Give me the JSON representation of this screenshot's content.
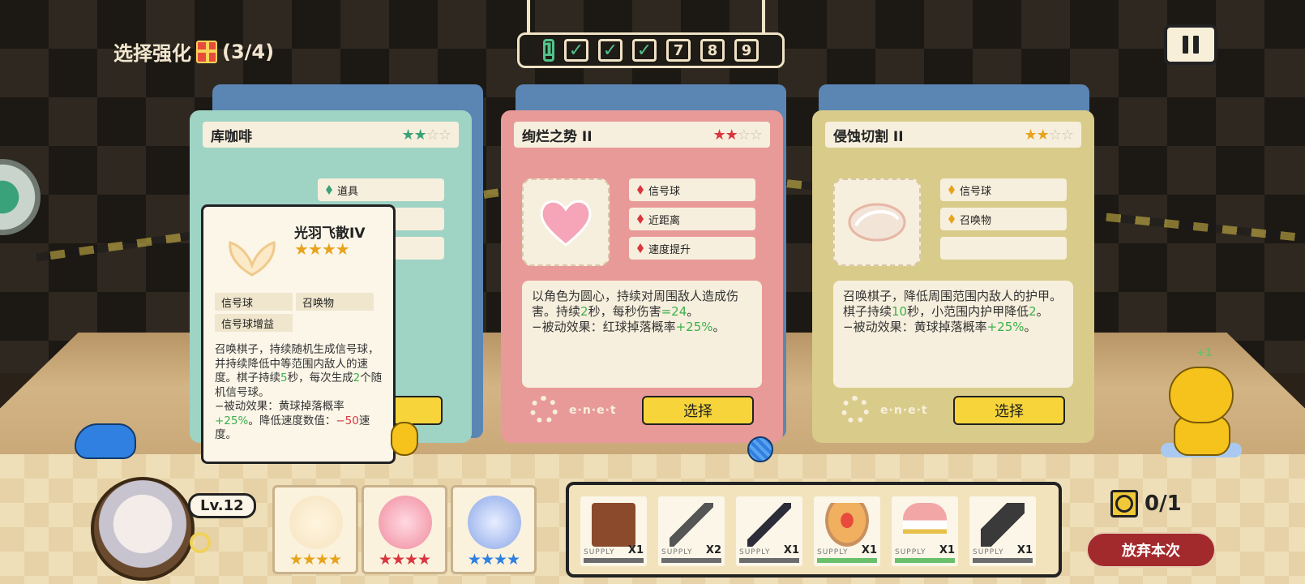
{
  "header": {
    "title": "选择强化",
    "progress": "(3/4)",
    "gift_icon": "gift-icon"
  },
  "stages": {
    "current_marker": "1",
    "done": [
      "✓",
      "✓",
      "✓"
    ],
    "upcoming": [
      "7",
      "8",
      "9"
    ]
  },
  "cards": [
    {
      "name": "库咖啡",
      "stars_filled": "★★",
      "stars_empty": "☆☆",
      "accent": "#3aa27a",
      "tags": [
        "道具"
      ],
      "select_label": "择"
    },
    {
      "name": "绚烂之势 II",
      "stars_filled": "★★",
      "stars_empty": "☆☆",
      "accent": "#d9363e",
      "tags": [
        "信号球",
        "近距离",
        "速度提升"
      ],
      "desc_a": "以角色为圆心，持续对周围敌人造成伤害。持续",
      "desc_b": "2",
      "desc_c": "秒，每秒伤害",
      "desc_d": "=24",
      "desc_e": "。",
      "passive_a": "−被动效果：红球掉落概率",
      "passive_b": "+25%",
      "passive_c": "。",
      "deco_text": "e·n·e·t",
      "select_label": "选择"
    },
    {
      "name": "侵蚀切割 II",
      "stars_filled": "★★",
      "stars_empty": "☆☆",
      "accent": "#e8a31c",
      "tags": [
        "信号球",
        "召唤物"
      ],
      "desc_a": "召唤棋子，降低周围范围内敌人的护甲。棋子持续",
      "desc_b": "10",
      "desc_c": "秒，小范围内护甲降低",
      "desc_d": "2",
      "desc_e": "。",
      "passive_a": "−被动效果：黄球掉落概率",
      "passive_b": "+25%",
      "passive_c": "。",
      "deco_text": "e·n·e·t",
      "select_label": "选择"
    }
  ],
  "tooltip": {
    "name": "光羽飞散IV",
    "stars": "★★★★",
    "tags": [
      "信号球",
      "召唤物",
      "信号球增益"
    ],
    "desc_1": "召唤棋子，持续随机生成信号球，并持续降低中等范围内敌人的速度。棋子持续",
    "desc_2": "5",
    "desc_3": "秒，每次生成",
    "desc_4": "2",
    "desc_5": "个随机信号球。",
    "passive_1": "−被动效果：黄球掉落概率",
    "passive_2": "+25%",
    "passive_3": "。降低速度数值：",
    "passive_4": "−50",
    "passive_5": "速度。"
  },
  "player": {
    "level": "Lv.12"
  },
  "slots": [
    {
      "stars": "★★★★",
      "color": "#e8a31c"
    },
    {
      "stars": "★★★★",
      "color": "#d9363e"
    },
    {
      "stars": "★★★★",
      "color": "#2f80e0"
    }
  ],
  "supplies": [
    {
      "label": "SUPPLY",
      "count": "X1",
      "icon": "coffee-grinder-icon",
      "bar": "grey"
    },
    {
      "label": "SUPPLY",
      "count": "X2",
      "icon": "crossbow-icon",
      "bar": "grey"
    },
    {
      "label": "SUPPLY",
      "count": "X1",
      "icon": "rifle-icon",
      "bar": "grey"
    },
    {
      "label": "SUPPLY",
      "count": "X1",
      "icon": "pancakes-icon",
      "bar": "green"
    },
    {
      "label": "SUPPLY",
      "count": "X1",
      "icon": "parfait-icon",
      "bar": "green"
    },
    {
      "label": "SUPPLY",
      "count": "X1",
      "icon": "gatling-icon",
      "bar": "grey"
    }
  ],
  "currency": {
    "value": "0/1"
  },
  "abandon_label": "放弃本次",
  "dog_bubble": "+1"
}
